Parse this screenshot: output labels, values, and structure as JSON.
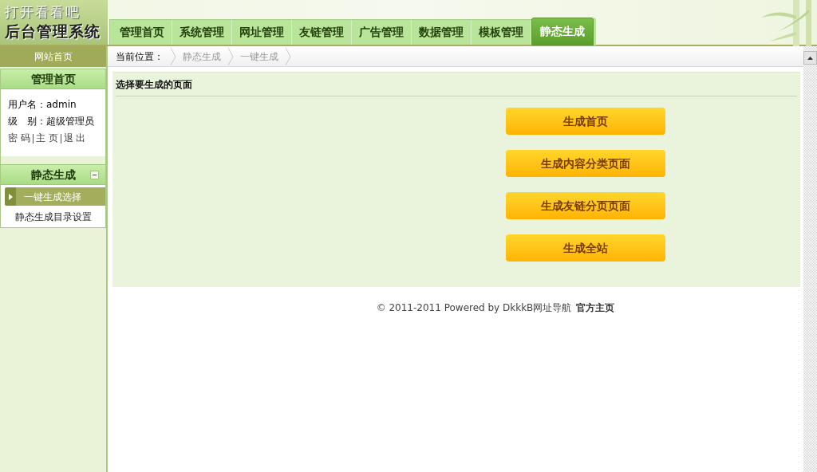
{
  "logo": {
    "line_1": "打开看看吧",
    "line_2": "后台管理系统"
  },
  "tabs": [
    {
      "label": "管理首页",
      "selected": false
    },
    {
      "label": "系统管理",
      "selected": false
    },
    {
      "label": "网址管理",
      "selected": false
    },
    {
      "label": "友链管理",
      "selected": false
    },
    {
      "label": "广告管理",
      "selected": false
    },
    {
      "label": "数据管理",
      "selected": false
    },
    {
      "label": "模板管理",
      "selected": false
    },
    {
      "label": "静态生成",
      "selected": true
    }
  ],
  "sidebar": {
    "home_link": "网站首页",
    "sections": [
      {
        "kind": "user_info",
        "title": "管理首页",
        "user_lines": [
          "用户名：admin",
          "级　别：超级管理员"
        ],
        "links": [
          "密 码",
          "主 页",
          "退 出"
        ]
      },
      {
        "kind": "menu",
        "title": "静态生成",
        "expanded": true,
        "items": [
          {
            "label": "一键生成选择",
            "selected": true
          },
          {
            "label": "静态生成目录设置",
            "selected": false
          }
        ]
      }
    ]
  },
  "breadcrumb": {
    "label": "当前位置：",
    "items": [
      "静态生成",
      "一键生成"
    ]
  },
  "panel": {
    "title": "选择要生成的页面",
    "buttons": [
      "生成首页",
      "生成内容分类页面",
      "生成友链分页页面",
      "生成全站"
    ]
  },
  "footer": {
    "text": "© 2011-2011 Powered by DkkkB网址导航",
    "link": "官方主页"
  }
}
